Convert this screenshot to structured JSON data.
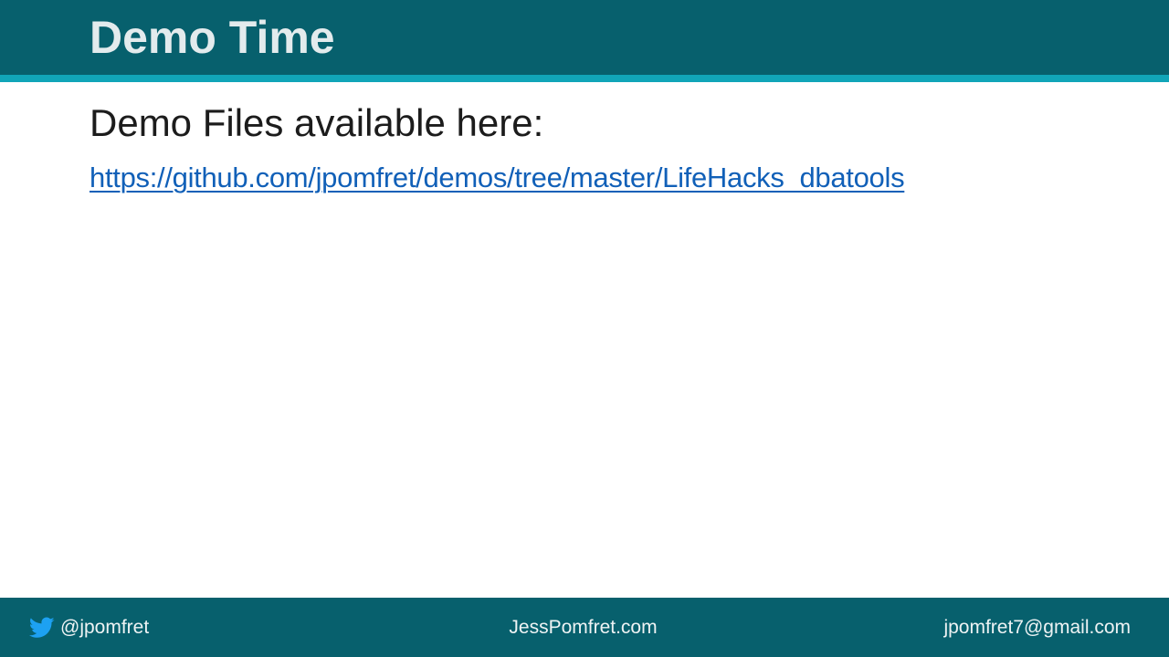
{
  "slide": {
    "title": "Demo Time",
    "heading": "Demo Files available here:",
    "link_text": "https://github.com/jpomfret/demos/tree/master/LifeHacks_dbatools"
  },
  "footer": {
    "twitter_icon": "twitter-bird-icon",
    "twitter_handle": "@jpomfret",
    "website": "JessPomfret.com",
    "email": "jpomfret7@gmail.com"
  },
  "colors": {
    "header_bg": "#07606d",
    "header_accent": "#11a5b8",
    "title_text": "#e3ebed",
    "link": "#1160b8",
    "footer_bg": "#07606d",
    "twitter_blue": "#1da1f2"
  }
}
